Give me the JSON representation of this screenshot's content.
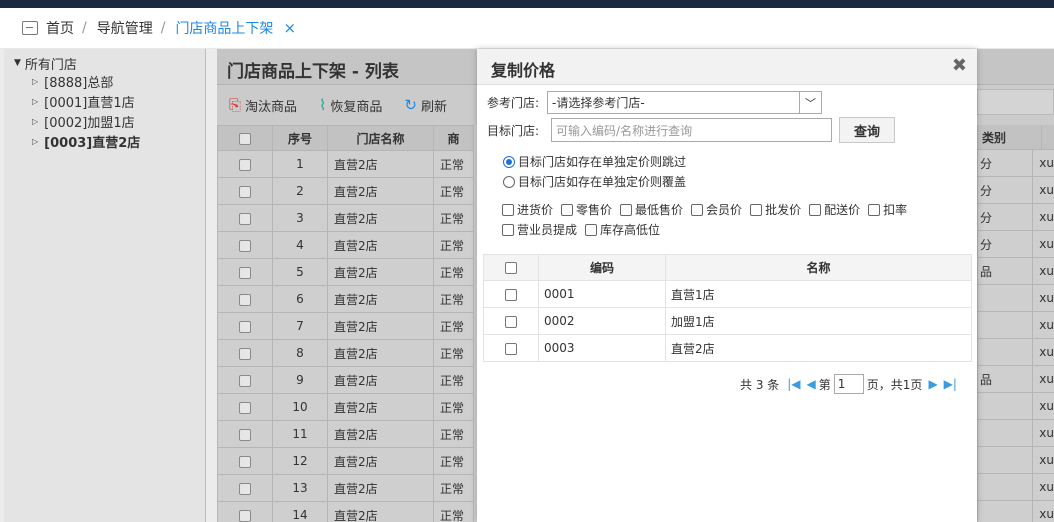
{
  "tabs": {
    "home": "首页",
    "nav": "导航管理",
    "active": "门店商品上下架",
    "close": "×"
  },
  "tree": {
    "root": "所有门店",
    "nodes": [
      "[8888]总部",
      "[0001]直营1店",
      "[0002]加盟1店",
      "[0003]直营2店"
    ]
  },
  "list": {
    "title": "门店商品上下架 - 列表",
    "toolbar": {
      "discard": "淘汰商品",
      "restore": "恢复商品",
      "refresh": "刷新"
    },
    "headers": {
      "no": "序号",
      "store": "门店名称",
      "goods": "商",
      "category": "类别"
    },
    "rows": [
      {
        "no": "1",
        "store": "直营2店",
        "status": "正常",
        "cat": "分",
        "x": "xu"
      },
      {
        "no": "2",
        "store": "直营2店",
        "status": "正常",
        "cat": "分",
        "x": "xu"
      },
      {
        "no": "3",
        "store": "直营2店",
        "status": "正常",
        "cat": "分",
        "x": "xu"
      },
      {
        "no": "4",
        "store": "直营2店",
        "status": "正常",
        "cat": "分",
        "x": "xu"
      },
      {
        "no": "5",
        "store": "直营2店",
        "status": "正常",
        "cat": "品",
        "x": "xu"
      },
      {
        "no": "6",
        "store": "直营2店",
        "status": "正常",
        "cat": "",
        "x": "xu"
      },
      {
        "no": "7",
        "store": "直营2店",
        "status": "正常",
        "cat": "",
        "x": "xu"
      },
      {
        "no": "8",
        "store": "直营2店",
        "status": "正常",
        "cat": "",
        "x": "xu"
      },
      {
        "no": "9",
        "store": "直营2店",
        "status": "正常",
        "cat": "品",
        "x": "xu"
      },
      {
        "no": "10",
        "store": "直营2店",
        "status": "正常",
        "cat": "",
        "x": "xu"
      },
      {
        "no": "11",
        "store": "直营2店",
        "status": "正常",
        "cat": "",
        "x": "xu"
      },
      {
        "no": "12",
        "store": "直营2店",
        "status": "正常",
        "cat": "",
        "x": "xu"
      },
      {
        "no": "13",
        "store": "直营2店",
        "status": "正常",
        "cat": "",
        "x": "xu"
      },
      {
        "no": "14",
        "store": "直营2店",
        "status": "正常",
        "cat": "",
        "x": "xu"
      }
    ]
  },
  "dialog": {
    "title": "复制价格",
    "close": "✖",
    "ref_store_label": "参考门店:",
    "ref_store_value": "-请选择参考门店-",
    "target_store_label": "目标门店:",
    "target_store_placeholder": "可输入编码/名称进行查询",
    "query_button": "查询",
    "radio_skip": "目标门店如存在单独定价则跳过",
    "radio_overwrite": "目标门店如存在单独定价则覆盖",
    "price_options": [
      "进货价",
      "零售价",
      "最低售价",
      "会员价",
      "批发价",
      "配送价",
      "扣率"
    ],
    "other_options": [
      "营业员提成",
      "库存高低位"
    ],
    "grid_headers": {
      "code": "编码",
      "name": "名称"
    },
    "grid_rows": [
      {
        "code": "0001",
        "name": "直营1店"
      },
      {
        "code": "0002",
        "name": "加盟1店"
      },
      {
        "code": "0003",
        "name": "直营2店"
      }
    ],
    "pager": {
      "total": "共 3 条",
      "page_prefix": "第",
      "page_value": "1",
      "page_suffix": "页，共1页"
    }
  }
}
